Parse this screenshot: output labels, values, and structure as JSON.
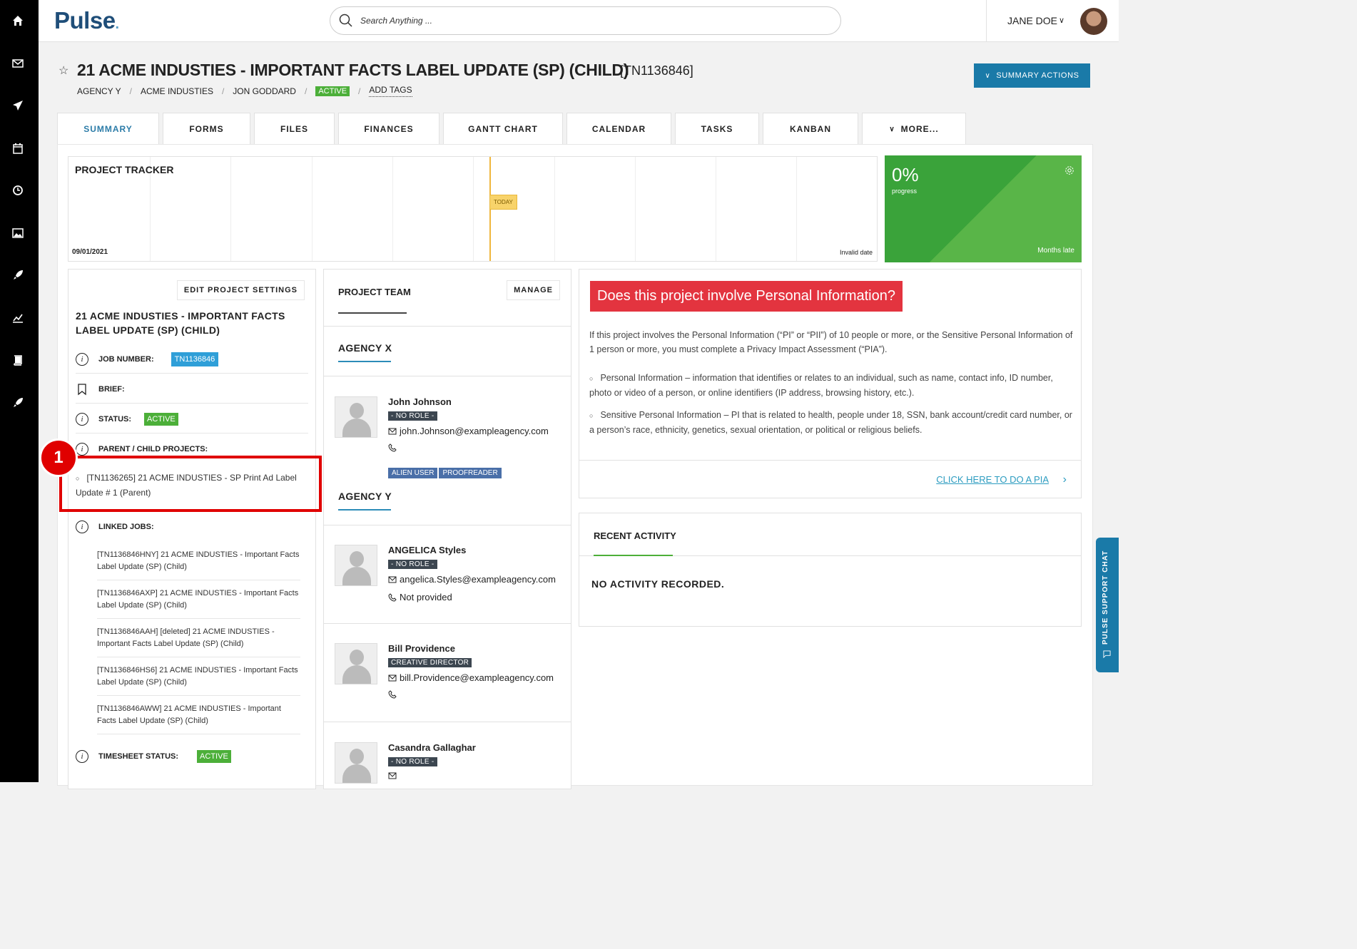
{
  "brand": {
    "logo_text": "Pulse",
    "logo_dot": "."
  },
  "search": {
    "placeholder": "Search Anything ..."
  },
  "user": {
    "name": "JANE DOE"
  },
  "sidebar": {
    "items": [
      {
        "icon": "home-icon"
      },
      {
        "icon": "mail-icon"
      },
      {
        "icon": "send-icon"
      },
      {
        "icon": "calendar-icon"
      },
      {
        "icon": "clock-icon"
      },
      {
        "icon": "image-icon"
      },
      {
        "icon": "rocket-icon"
      },
      {
        "icon": "chart-icon"
      },
      {
        "icon": "book-icon"
      },
      {
        "icon": "rocket-icon"
      }
    ]
  },
  "project": {
    "title": "21 ACME INDUSTIES - IMPORTANT FACTS LABEL UPDATE (SP) (CHILD)",
    "id": "[TN1136846]",
    "breadcrumb": [
      "AGENCY Y",
      "ACME INDUSTIES",
      "JON GODDARD"
    ],
    "status_badge": "ACTIVE",
    "add_tags": "ADD TAGS",
    "summary_actions": "SUMMARY ACTIONS"
  },
  "tabs": [
    {
      "label": "SUMMARY",
      "active": true
    },
    {
      "label": "FORMS"
    },
    {
      "label": "FILES"
    },
    {
      "label": "FINANCES"
    },
    {
      "label": "GANTT CHART"
    },
    {
      "label": "CALENDAR"
    },
    {
      "label": "TASKS"
    },
    {
      "label": "KANBAN"
    },
    {
      "label": "MORE..."
    }
  ],
  "tracker": {
    "title": "PROJECT TRACKER",
    "start_date": "09/01/2021",
    "end_date": "Invalid date",
    "today_label": "TODAY"
  },
  "progress": {
    "percent": "0%",
    "label": "progress",
    "late": "Months late",
    "value": 0,
    "color": "#3aa33a"
  },
  "details": {
    "edit_button": "EDIT PROJECT SETTINGS",
    "title": "21 ACME INDUSTIES - IMPORTANT FACTS LABEL UPDATE (SP) (CHILD)",
    "job_number_label": "JOB NUMBER:",
    "job_number": "TN1136846",
    "brief_label": "BRIEF:",
    "status_label": "STATUS:",
    "status": "ACTIVE",
    "parent_child_label": "PARENT / CHILD PROJECTS:",
    "parent_project": "[TN1136265] 21 ACME INDUSTIES - SP Print Ad Label Update # 1 (Parent)",
    "linked_jobs_label": "LINKED JOBS:",
    "linked_jobs": [
      "[TN1136846HNY] 21 ACME INDUSTIES - Important Facts Label Update (SP) (Child)",
      "[TN1136846AXP] 21 ACME INDUSTIES - Important Facts Label Update (SP) (Child)",
      "[TN1136846AAH] [deleted] 21 ACME INDUSTIES - Important Facts Label Update (SP) (Child)",
      "[TN1136846HS6] 21 ACME INDUSTIES - Important Facts Label Update (SP) (Child)",
      "[TN1136846AWW] 21 ACME INDUSTIES - Important Facts Label Update (SP) (Child)"
    ],
    "timesheet_label": "TIMESHEET STATUS:",
    "timesheet_status": "ACTIVE",
    "step_number": "1"
  },
  "team": {
    "title": "PROJECT TEAM",
    "manage_button": "MANAGE",
    "agencies": [
      {
        "name": "AGENCY X",
        "members": [
          {
            "name": "John Johnson",
            "role": "- NO ROLE -",
            "email": "john.Johnson@exampleagency.com",
            "phone": "",
            "tags": [
              "ALIEN USER",
              "PROOFREADER"
            ]
          }
        ]
      },
      {
        "name": "AGENCY Y",
        "members": [
          {
            "name": "ANGELICA Styles",
            "role": "- NO ROLE -",
            "email": "angelica.Styles@exampleagency.com",
            "phone": "Not provided"
          },
          {
            "name": "Bill Providence",
            "role": "CREATIVE DIRECTOR",
            "email": "bill.Providence@exampleagency.com",
            "phone": ""
          },
          {
            "name": "Casandra Gallaghar",
            "role": "- NO ROLE -",
            "email": "",
            "phone": ""
          }
        ]
      }
    ]
  },
  "pi": {
    "banner": "Does this project involve Personal Information?",
    "intro": "If this project involves the Personal Information (“PI” or “PII”) of 10 people or more, or the Sensitive Personal Information of 1 person or more, you must complete a Privacy Impact Assessment (“PIA”).",
    "bullet1": "Personal Information – information that identifies or relates to an individual, such as name, contact info, ID number, photo or video of a person, or online identifiers (IP address, browsing history, etc.).",
    "bullet2": "Sensitive Personal Information – PI that is related to health, people under 18, SSN, bank account/credit card number, or a person’s race, ethnicity, genetics, sexual orientation, or political or religious beliefs.",
    "link": "CLICK HERE TO DO A PIA",
    "banner_color": "#e3343f"
  },
  "activity": {
    "title": "RECENT ACTIVITY",
    "empty": "NO ACTIVITY RECORDED."
  },
  "support_chat": {
    "label": "PULSE SUPPORT CHAT"
  }
}
